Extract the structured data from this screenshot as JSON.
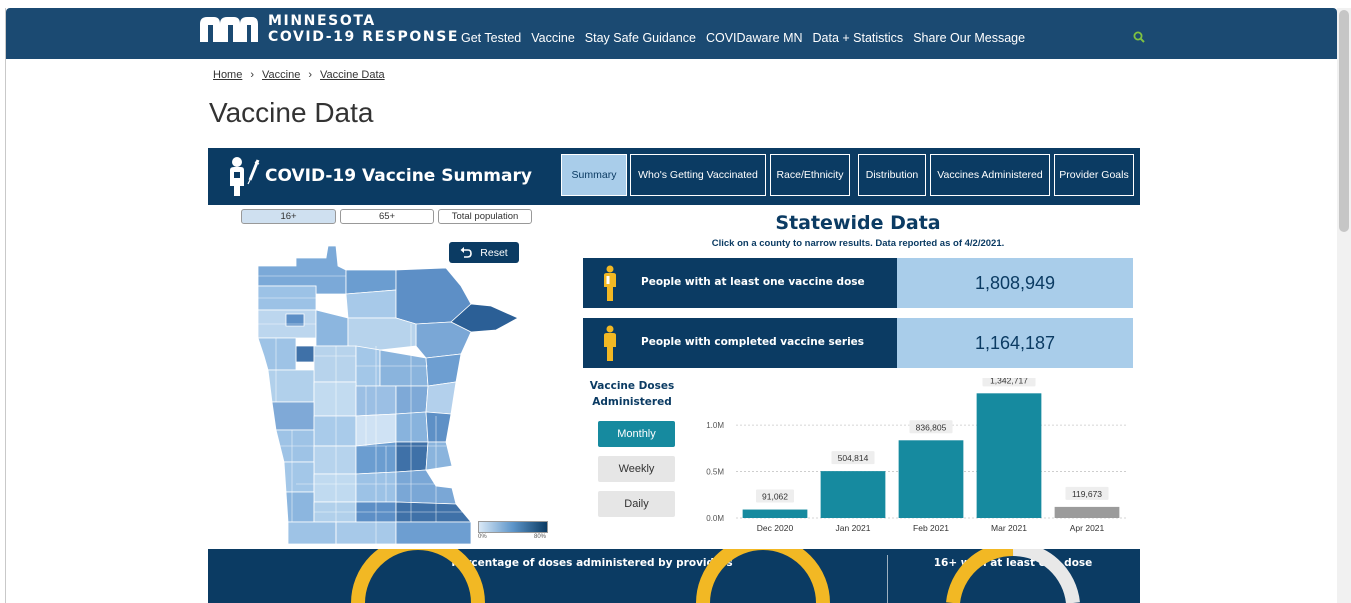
{
  "header": {
    "logo_line1": "MINNESOTA",
    "logo_line2": "COVID-19 RESPONSE",
    "nav": [
      "Get Tested",
      "Vaccine",
      "Stay Safe Guidance",
      "COVIDaware MN",
      "Data + Statistics",
      "Share Our Message"
    ],
    "search_icon": "search-icon"
  },
  "breadcrumb": [
    "Home",
    "Vaccine",
    "Vaccine Data"
  ],
  "page_title": "Vaccine Data",
  "dashboard": {
    "title": "COVID-19 Vaccine Summary",
    "tabs": [
      "Summary",
      "Who's Getting Vaccinated",
      "Race/Ethnicity",
      "Distribution",
      "Vaccines Administered",
      "Provider Goals"
    ],
    "active_tab": "Summary",
    "age_filters": [
      "16+",
      "65+",
      "Total population"
    ],
    "active_age": "16+",
    "reset_label": "Reset",
    "legend_min": "0%",
    "legend_max": "80%",
    "statewide_title": "Statewide Data",
    "statewide_sub": "Click on a county to narrow results. Data reported as of 4/2/2021.",
    "kpis": [
      {
        "label": "People with at least one vaccine dose",
        "value": "1,808,949"
      },
      {
        "label": "People with completed vaccine series",
        "value": "1,164,187"
      }
    ],
    "doses_title_line1": "Vaccine Doses",
    "doses_title_line2": "Administered",
    "periods": [
      "Monthly",
      "Weekly",
      "Daily"
    ],
    "active_period": "Monthly",
    "bottom_title_left": "Percentage of doses administered by providers",
    "bottom_title_right": "16+ with at least one dose",
    "colors": {
      "navy": "#0b3b63",
      "teal": "#168a9f",
      "light_blue": "#a9cdea",
      "gold": "#f2b824",
      "gray": "#9b9b9b"
    }
  },
  "chart_data": {
    "type": "bar",
    "categories": [
      "Dec 2020",
      "Jan 2021",
      "Feb 2021",
      "Mar 2021",
      "Apr 2021"
    ],
    "values": [
      91062,
      504814,
      836805,
      1342717,
      119673
    ],
    "value_labels": [
      "91,062",
      "504,814",
      "836,805",
      "1,342,717",
      "119,673"
    ],
    "yticks": [
      "0.0M",
      "0.5M",
      "1.0M"
    ],
    "ytick_values": [
      0,
      500000,
      1000000
    ],
    "ylim": [
      0,
      1400000
    ],
    "bar_colors": [
      "#168a9f",
      "#168a9f",
      "#168a9f",
      "#168a9f",
      "#9b9b9b"
    ],
    "grid": true
  }
}
